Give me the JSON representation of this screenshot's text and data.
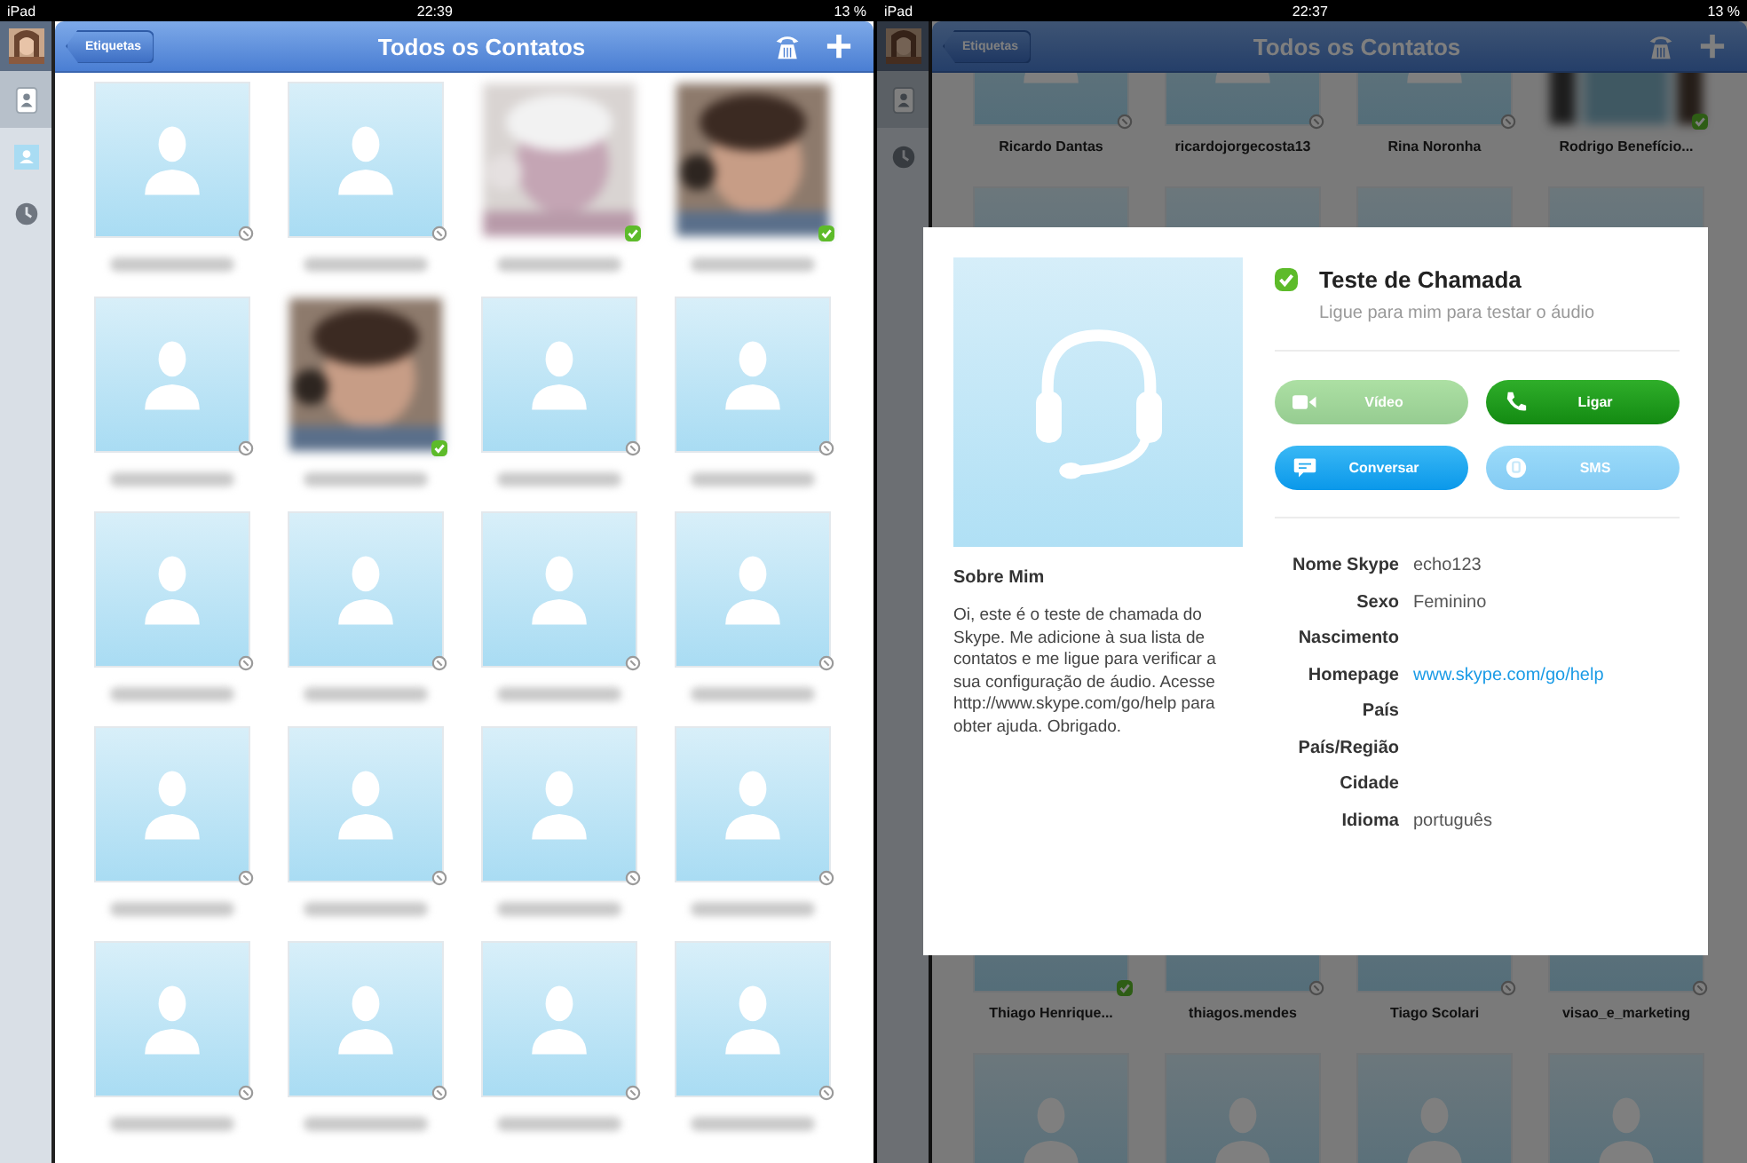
{
  "left": {
    "status_bar": {
      "device": "iPad",
      "time": "22:39",
      "battery": "13 %"
    },
    "sidebar": {
      "items": [
        {
          "kind": "contacts",
          "selected": true
        },
        {
          "kind": "person",
          "selected": false
        },
        {
          "kind": "recent",
          "selected": false
        }
      ]
    },
    "nav": {
      "back": "Etiquetas",
      "title": "Todos os Contatos"
    },
    "contacts": [
      {
        "kind": "avatar",
        "online": false
      },
      {
        "kind": "avatar",
        "online": false
      },
      {
        "kind": "picture",
        "online": true
      },
      {
        "kind": "picture",
        "online": true
      },
      {
        "kind": "avatar",
        "online": false
      },
      {
        "kind": "picture",
        "online": true
      },
      {
        "kind": "avatar",
        "online": false
      },
      {
        "kind": "avatar",
        "online": false
      },
      {
        "kind": "avatar",
        "online": false
      },
      {
        "kind": "avatar",
        "online": false
      },
      {
        "kind": "avatar",
        "online": false
      },
      {
        "kind": "avatar",
        "online": false
      },
      {
        "kind": "avatar",
        "online": false
      },
      {
        "kind": "avatar",
        "online": false
      },
      {
        "kind": "avatar",
        "online": false
      },
      {
        "kind": "avatar",
        "online": false
      },
      {
        "kind": "avatar",
        "online": false
      },
      {
        "kind": "avatar",
        "online": false
      },
      {
        "kind": "avatar",
        "online": false
      },
      {
        "kind": "avatar",
        "online": false
      }
    ]
  },
  "right": {
    "status_bar": {
      "device": "iPad",
      "time": "22:37",
      "battery": "13 %"
    },
    "sidebar": {
      "items": [
        {
          "kind": "contacts",
          "selected": true
        },
        {
          "kind": "recent",
          "selected": false
        }
      ]
    },
    "nav": {
      "back": "Etiquetas",
      "title": "Todos os Contatos"
    },
    "contact_rows": [
      {
        "contacts": [
          {
            "kind": "avatar",
            "online": false,
            "name": "Ricardo Dantas"
          },
          {
            "kind": "avatar",
            "online": false,
            "name": "ricardojorgecosta13"
          },
          {
            "kind": "avatar",
            "online": false,
            "name": "Rina Noronha"
          },
          {
            "kind": "picture",
            "online": true,
            "name": "Rodrigo Benefício..."
          }
        ]
      },
      {
        "contacts": [
          {
            "kind": "blank"
          },
          {
            "kind": "blank"
          },
          {
            "kind": "blank"
          },
          {
            "kind": "blank"
          }
        ]
      },
      {
        "contacts": [
          {
            "kind": "blank",
            "online": true,
            "name": "Thiago Henrique..."
          },
          {
            "kind": "blank",
            "online": false,
            "name": "thiagos.mendes"
          },
          {
            "kind": "blank",
            "online": false,
            "name": "Tiago Scolari"
          },
          {
            "kind": "blank",
            "online": false,
            "name": "visao_e_marketing"
          }
        ]
      },
      {
        "contacts": [
          {
            "kind": "avatar"
          },
          {
            "kind": "avatar"
          },
          {
            "kind": "avatar"
          },
          {
            "kind": "avatar"
          }
        ]
      }
    ],
    "dialog": {
      "name": "Teste de Chamada",
      "online": true,
      "mood": "Ligue para mim para testar o áudio",
      "buttons": [
        {
          "kind": "video",
          "label": "Vídeo",
          "disabled": true
        },
        {
          "kind": "call",
          "label": "Ligar",
          "disabled": false
        },
        {
          "kind": "chat",
          "label": "Conversar",
          "disabled": false
        },
        {
          "kind": "sms",
          "label": "SMS",
          "disabled": true
        }
      ],
      "about_title": "Sobre Mim",
      "about": "Oi, este é o teste de chamada do Skype. Me adicione à sua lista de contatos e me ligue para verificar a sua configuração de áudio. Acesse http://www.skype.com/go/help para obter ajuda. Obrigado.",
      "fields": [
        {
          "label": "Nome Skype",
          "value": "echo123",
          "kind": "text"
        },
        {
          "label": "Sexo",
          "value": "Feminino",
          "kind": "text"
        },
        {
          "label": "Nascimento",
          "kind": "text"
        },
        {
          "label": "Homepage",
          "value": "www.skype.com/go/help",
          "kind": "link"
        },
        {
          "label": "País",
          "kind": "text"
        },
        {
          "label": "País/Região",
          "kind": "text"
        },
        {
          "label": "Cidade",
          "kind": "text"
        },
        {
          "label": "Idioma",
          "value": "português",
          "kind": "text"
        }
      ]
    }
  }
}
